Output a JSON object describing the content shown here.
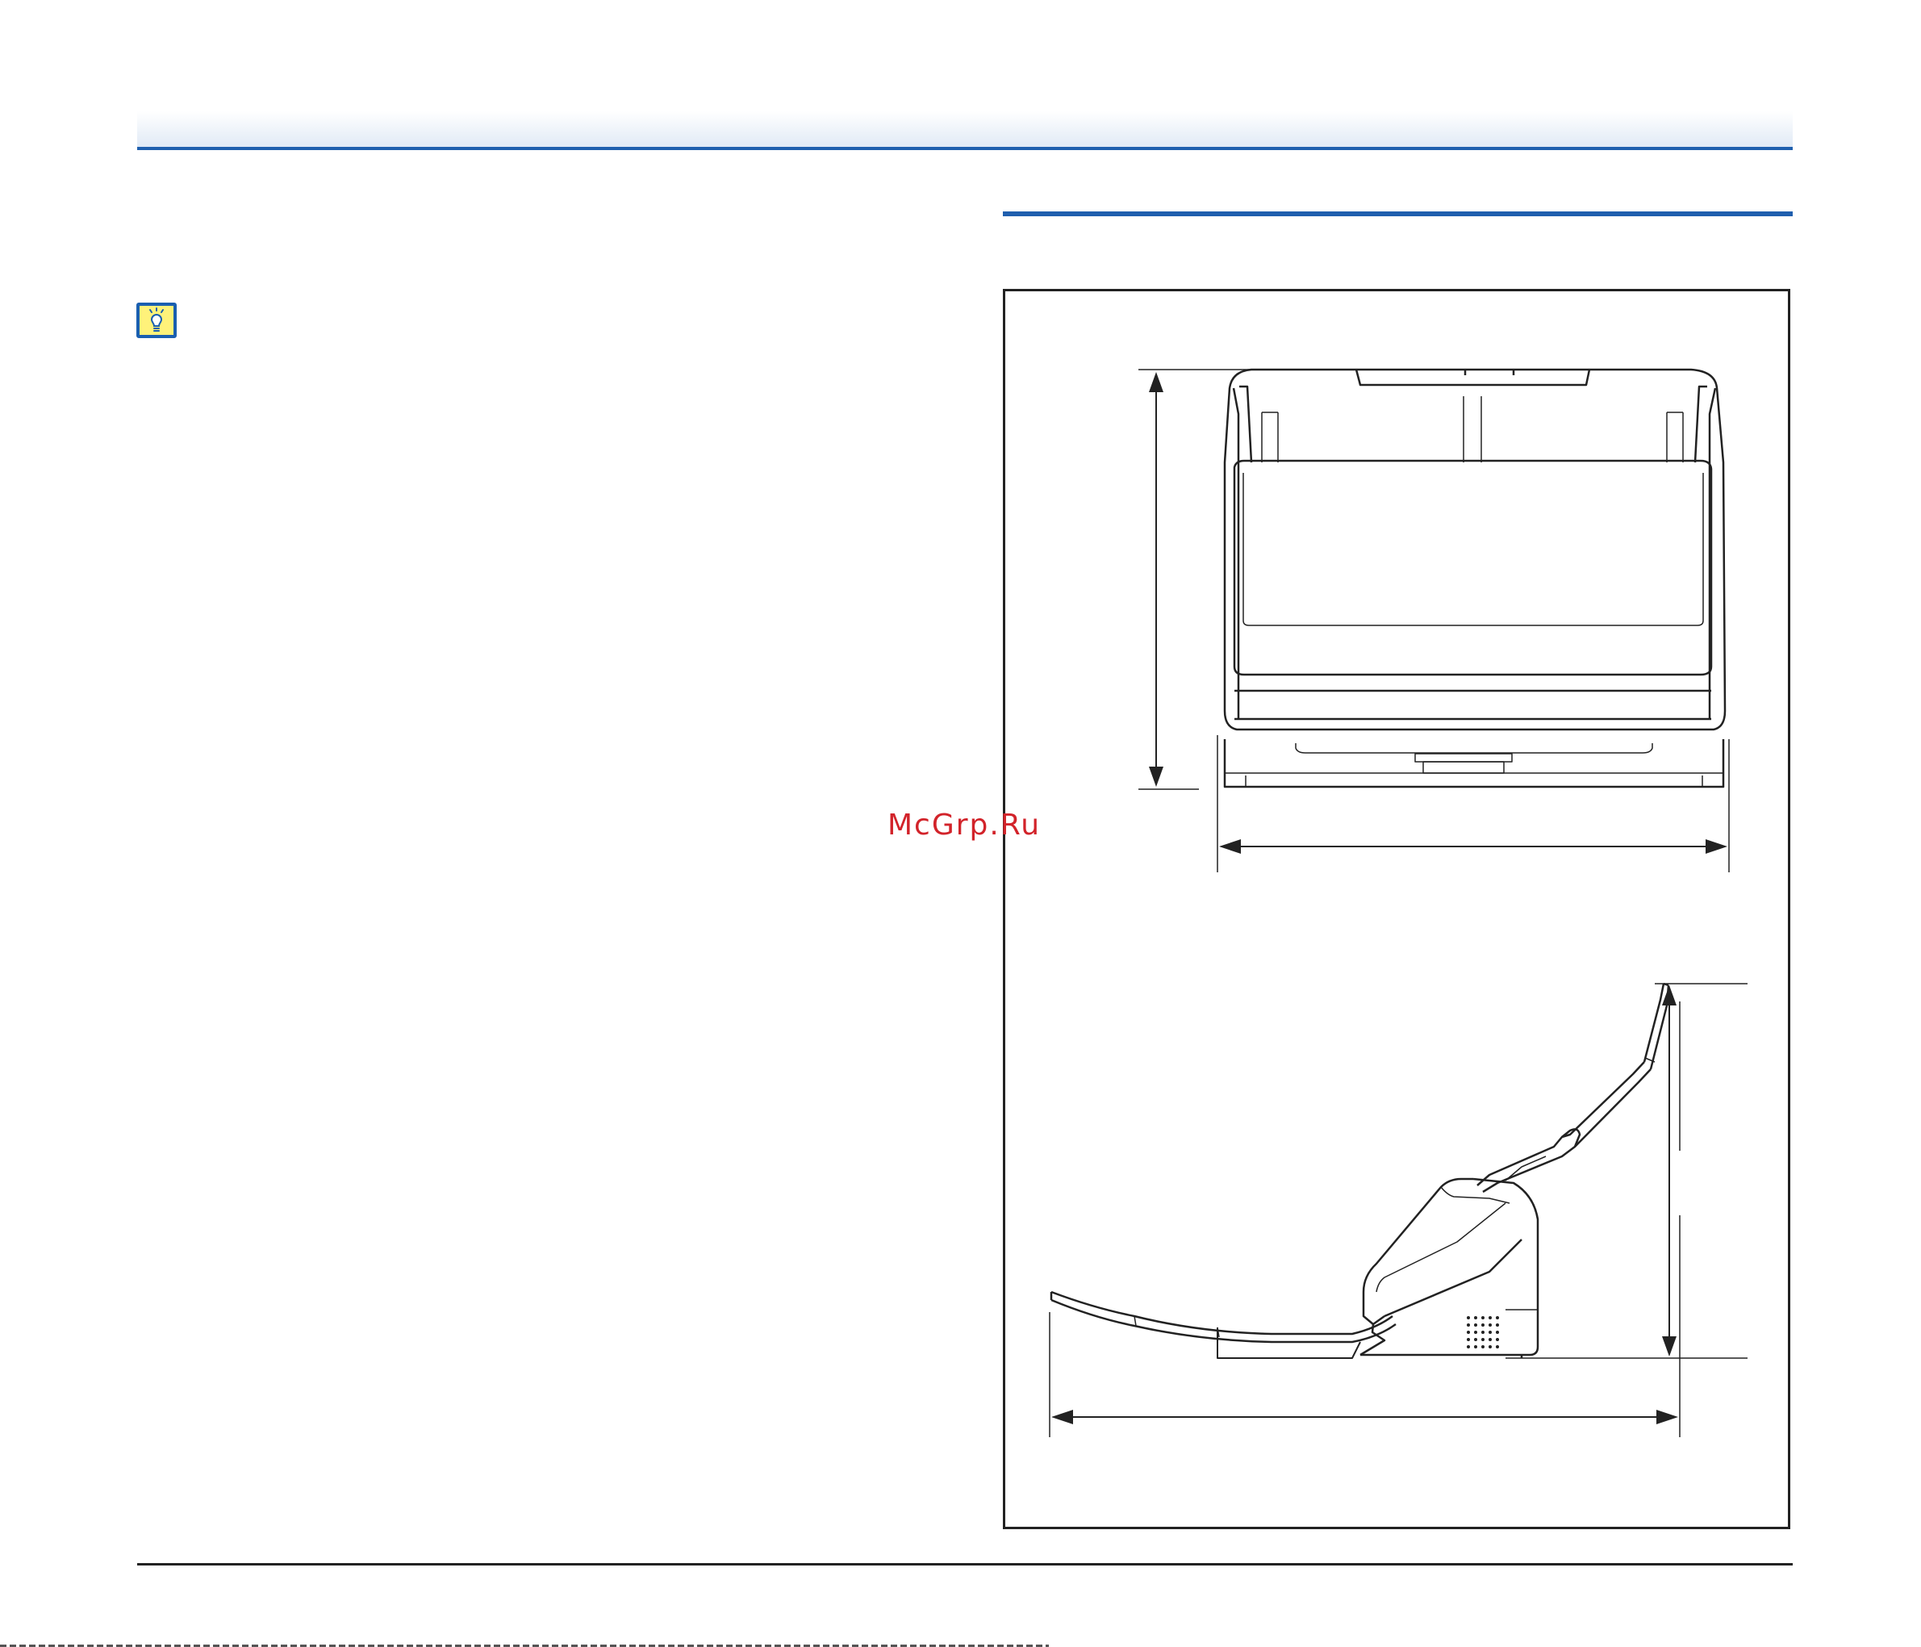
{
  "watermark": {
    "text": "McGrp.Ru",
    "color": "#d2232a"
  },
  "colors": {
    "accent_blue": "#1f5fae",
    "hint_icon_fill": "#fff27a"
  },
  "icons": {
    "hint": "lightbulb-icon"
  },
  "figure": {
    "views": [
      "front-view",
      "side-view"
    ],
    "dimension_labels": []
  }
}
